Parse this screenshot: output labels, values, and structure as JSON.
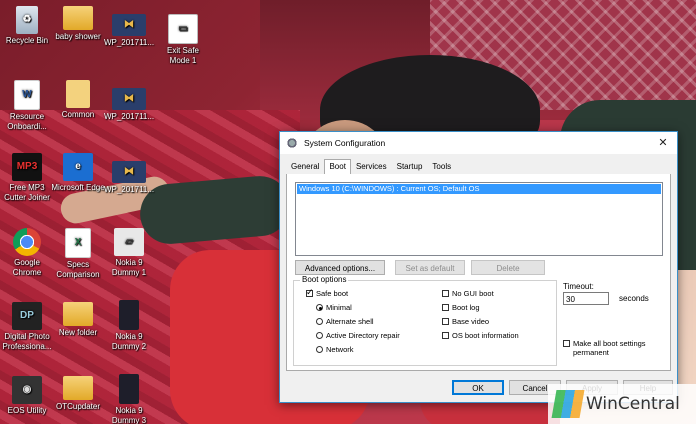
{
  "desktop": {
    "icons": [
      {
        "label": "Recycle Bin",
        "icon": "recycle-bin-icon"
      },
      {
        "label": "baby shower",
        "icon": "folder-icon"
      },
      {
        "label": "WP_201711...",
        "icon": "image-thumbnail-icon"
      },
      {
        "label": "Exit Safe Mode 1",
        "icon": "shortcut-icon"
      },
      {
        "label": "Resource Onboardi...",
        "icon": "word-document-icon"
      },
      {
        "label": "Common",
        "icon": "folder-icon"
      },
      {
        "label": "WP_201711...",
        "icon": "image-thumbnail-icon"
      },
      {
        "label": "Free MP3 Cutter Joiner",
        "icon": "mp3-app-icon"
      },
      {
        "label": "Microsoft Edge",
        "icon": "edge-icon"
      },
      {
        "label": "WP_201711...",
        "icon": "image-thumbnail-icon"
      },
      {
        "label": "Google Chrome",
        "icon": "chrome-icon"
      },
      {
        "label": "Specs Comparison",
        "icon": "excel-icon"
      },
      {
        "label": "Nokia 9 Dummy 1",
        "icon": "image-file-icon"
      },
      {
        "label": "Digital Photo Professiona...",
        "icon": "photo-app-icon"
      },
      {
        "label": "New folder",
        "icon": "folder-icon"
      },
      {
        "label": "Nokia 9 Dummy 2",
        "icon": "phone-image-icon"
      },
      {
        "label": "EOS Utility",
        "icon": "camera-icon"
      },
      {
        "label": "OTCupdater",
        "icon": "folder-icon"
      },
      {
        "label": "Nokia 9 Dummy 3",
        "icon": "phone-image-icon"
      }
    ]
  },
  "window": {
    "title": "System Configuration",
    "close_glyph": "✕",
    "tabs": [
      {
        "label": "General"
      },
      {
        "label": "Boot"
      },
      {
        "label": "Services"
      },
      {
        "label": "Startup"
      },
      {
        "label": "Tools"
      }
    ],
    "active_tab": "Boot",
    "os_list": [
      "Windows 10 (C:\\WINDOWS) : Current OS; Default OS"
    ],
    "buttons": {
      "advanced": "Advanced options...",
      "set_default": "Set as default",
      "delete": "Delete",
      "ok": "OK",
      "cancel": "Cancel",
      "apply": "Apply",
      "help": "Help"
    },
    "boot_options": {
      "legend": "Boot options",
      "safe_boot": {
        "label": "Safe boot",
        "checked": true
      },
      "minimal": {
        "label": "Minimal",
        "checked": true
      },
      "alternate_shell": {
        "label": "Alternate shell",
        "checked": false
      },
      "ad_repair": {
        "label": "Active Directory repair",
        "checked": false
      },
      "network": {
        "label": "Network",
        "checked": false
      },
      "no_gui": {
        "label": "No GUI boot",
        "checked": false
      },
      "boot_log": {
        "label": "Boot log",
        "checked": false
      },
      "base_video": {
        "label": "Base video",
        "checked": false
      },
      "os_boot_info": {
        "label": "OS boot information",
        "checked": false
      }
    },
    "timeout": {
      "label": "Timeout:",
      "value": "30",
      "unit": "seconds"
    },
    "make_permanent": {
      "label": "Make all boot settings permanent",
      "checked": false
    }
  },
  "watermark": {
    "text": "WinCentral"
  }
}
